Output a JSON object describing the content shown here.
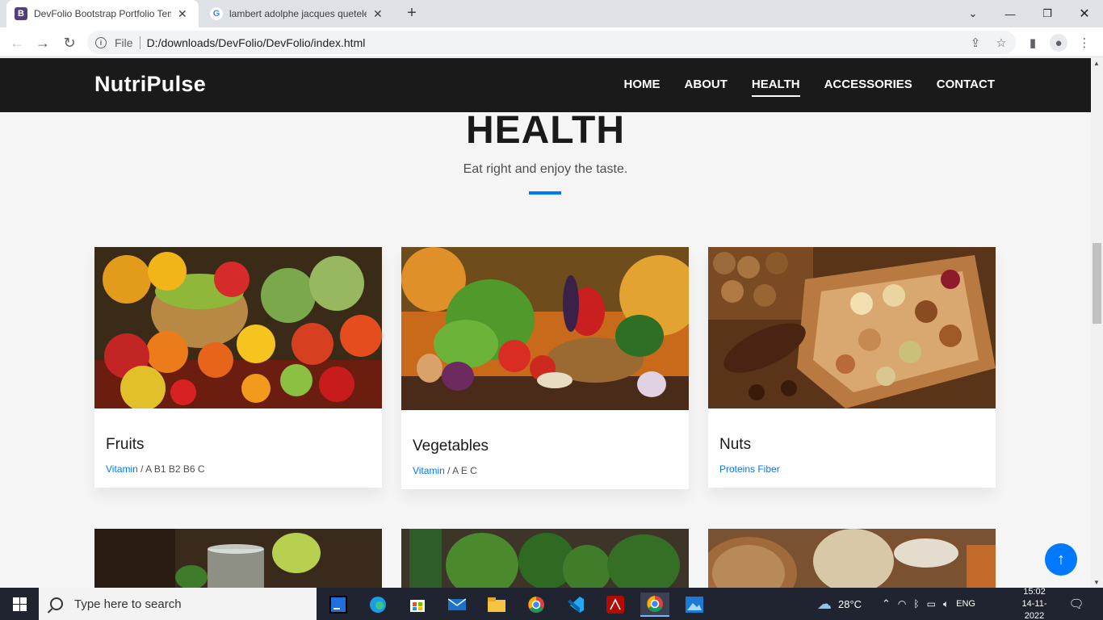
{
  "browser": {
    "tabs": [
      {
        "title": "DevFolio Bootstrap Portfolio Tem",
        "favicon": "B",
        "favicon_color": "#563d7c",
        "active": true
      },
      {
        "title": "lambert adolphe jacques quetele",
        "favicon": "G",
        "favicon_color": "#ffffff",
        "active": false
      }
    ],
    "new_tab": "+",
    "address": {
      "scheme_label": "File",
      "url": "D:/downloads/DevFolio/DevFolio/index.html"
    }
  },
  "site": {
    "brand": "NutriPulse",
    "nav": [
      {
        "label": "HOME",
        "active": false
      },
      {
        "label": "ABOUT",
        "active": false
      },
      {
        "label": "HEALTH",
        "active": true
      },
      {
        "label": "ACCESSORIES",
        "active": false
      },
      {
        "label": "CONTACT",
        "active": false
      }
    ],
    "section": {
      "title": "HEALTH",
      "subtitle": "Eat right and enjoy the taste."
    },
    "cards": [
      {
        "title": "Fruits",
        "link": "Vitamin",
        "rest": " / A B1 B2 B6 C",
        "image": "fruits-photo"
      },
      {
        "title": "Vegetables",
        "link": "Vitamin",
        "rest": " / A E C",
        "image": "vegetables-photo"
      },
      {
        "title": "Nuts",
        "link": "Proteins Fiber",
        "rest": "",
        "image": "nuts-photo"
      }
    ],
    "accent_color": "#0078ff"
  },
  "taskbar": {
    "search_placeholder": "Type here to search",
    "weather": "28°C",
    "language": "ENG",
    "time": "15:02",
    "date": "14-11-2022"
  }
}
